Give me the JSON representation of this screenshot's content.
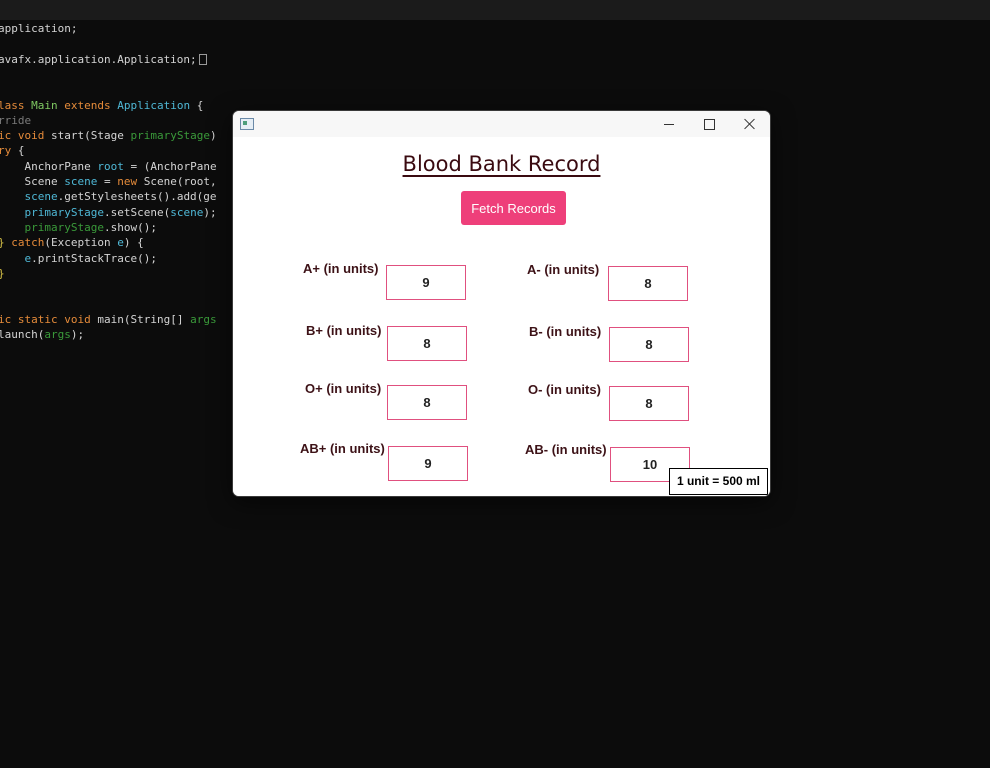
{
  "editor": {
    "lines": [
      [
        {
          "t": "application;",
          "c": "white"
        }
      ],
      [],
      [
        {
          "t": "avafx.application.Application;",
          "c": "white"
        }
      ],
      [],
      [],
      [
        {
          "t": "lass ",
          "c": "orange"
        },
        {
          "t": "Main ",
          "c": "green"
        },
        {
          "t": "extends ",
          "c": "orange"
        },
        {
          "t": "Application ",
          "c": "cyan"
        },
        {
          "t": "{",
          "c": "white"
        }
      ],
      [
        {
          "t": "rride",
          "c": "gray"
        }
      ],
      [
        {
          "t": "ic ",
          "c": "orange"
        },
        {
          "t": "void ",
          "c": "orange"
        },
        {
          "t": "start",
          "c": "white"
        },
        {
          "t": "(",
          "c": "white"
        },
        {
          "t": "Stage ",
          "c": "white"
        },
        {
          "t": "primaryStage",
          "c": "dgreen"
        },
        {
          "t": ")",
          "c": "white"
        }
      ],
      [
        {
          "t": "ry ",
          "c": "orange"
        },
        {
          "t": "{",
          "c": "white"
        }
      ],
      [
        {
          "t": "    AnchorPane ",
          "c": "white"
        },
        {
          "t": "root ",
          "c": "cyan"
        },
        {
          "t": "= (AnchorPane",
          "c": "white"
        }
      ],
      [
        {
          "t": "    Scene ",
          "c": "white"
        },
        {
          "t": "scene ",
          "c": "cyan"
        },
        {
          "t": "= ",
          "c": "white"
        },
        {
          "t": "new ",
          "c": "orange"
        },
        {
          "t": "Scene(root,",
          "c": "white"
        }
      ],
      [
        {
          "t": "    scene",
          "c": "cyan"
        },
        {
          "t": ".getStylesheets().add(ge",
          "c": "white"
        }
      ],
      [
        {
          "t": "    primaryStage",
          "c": "cyan"
        },
        {
          "t": ".setScene(",
          "c": "white"
        },
        {
          "t": "scene",
          "c": "cyan"
        },
        {
          "t": ");",
          "c": "white"
        }
      ],
      [
        {
          "t": "    primaryStage",
          "c": "dgreen"
        },
        {
          "t": ".show();",
          "c": "white"
        }
      ],
      [
        {
          "t": "} ",
          "c": "yellow"
        },
        {
          "t": "catch",
          "c": "orange"
        },
        {
          "t": "(Exception ",
          "c": "white"
        },
        {
          "t": "e",
          "c": "cyan"
        },
        {
          "t": ") {",
          "c": "white"
        }
      ],
      [
        {
          "t": "    e",
          "c": "cyan"
        },
        {
          "t": ".printStackTrace();",
          "c": "white"
        }
      ],
      [
        {
          "t": "}",
          "c": "yellow"
        }
      ],
      [],
      [],
      [
        {
          "t": "ic ",
          "c": "orange"
        },
        {
          "t": "static ",
          "c": "orange"
        },
        {
          "t": "void ",
          "c": "orange"
        },
        {
          "t": "main",
          "c": "white"
        },
        {
          "t": "(String[] ",
          "c": "white"
        },
        {
          "t": "args",
          "c": "dgreen"
        }
      ],
      [
        {
          "t": "launch(",
          "c": "white"
        },
        {
          "t": "args",
          "c": "dgreen"
        },
        {
          "t": ");",
          "c": "white"
        }
      ]
    ]
  },
  "window": {
    "icon": "app-window-icon",
    "controls": {
      "minimize": "minimize-icon",
      "maximize": "maximize-icon",
      "close": "close-icon"
    }
  },
  "app": {
    "title": "Blood Bank Record",
    "fetch_label": "Fetch Records",
    "groups": [
      {
        "id": "a-pos",
        "label": "A+ (in units)",
        "value": "9"
      },
      {
        "id": "a-neg",
        "label": "A- (in units)",
        "value": "8"
      },
      {
        "id": "b-pos",
        "label": "B+ (in units)",
        "value": "8"
      },
      {
        "id": "b-neg",
        "label": "B- (in units)",
        "value": "8"
      },
      {
        "id": "o-pos",
        "label": "O+ (in units)",
        "value": "8"
      },
      {
        "id": "o-neg",
        "label": "O- (in units)",
        "value": "8"
      },
      {
        "id": "ab-pos",
        "label": "AB+ (in units)",
        "value": "9"
      },
      {
        "id": "ab-neg",
        "label": "AB- (in units)",
        "value": "10"
      }
    ],
    "unit_note": "1 unit = 500 ml"
  },
  "colors": {
    "accent": "#ee3f7a",
    "field_border": "#e0507f",
    "label_text": "#3d1217"
  }
}
